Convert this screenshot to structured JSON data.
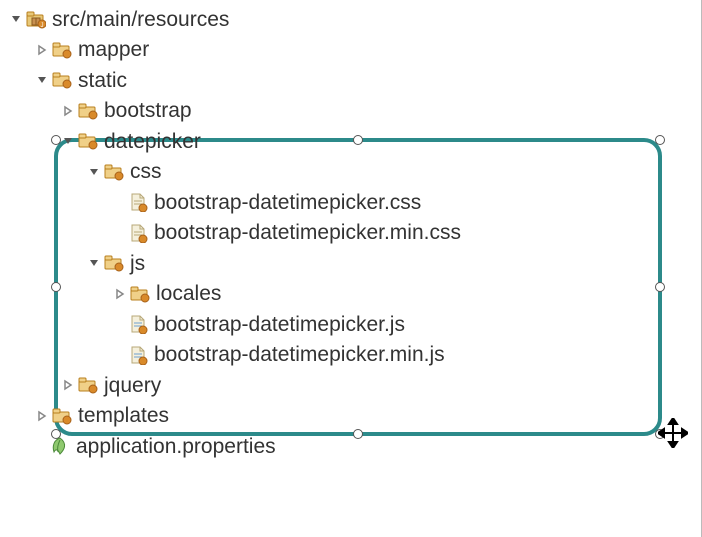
{
  "tree": {
    "root": {
      "label": "src/main/resources",
      "expanded": true,
      "children": {
        "mapper": {
          "label": "mapper",
          "expanded": false
        },
        "static": {
          "label": "static",
          "expanded": true,
          "children": {
            "bootstrap": {
              "label": "bootstrap",
              "expanded": false
            },
            "datepicker": {
              "label": "datepicker",
              "expanded": true,
              "children": {
                "css": {
                  "label": "css",
                  "expanded": true,
                  "children": {
                    "f1": {
                      "label": "bootstrap-datetimepicker.css"
                    },
                    "f2": {
                      "label": "bootstrap-datetimepicker.min.css"
                    }
                  }
                },
                "js": {
                  "label": "js",
                  "expanded": true,
                  "children": {
                    "locales": {
                      "label": "locales",
                      "expanded": false
                    },
                    "f3": {
                      "label": "bootstrap-datetimepicker.js"
                    },
                    "f4": {
                      "label": "bootstrap-datetimepicker.min.js"
                    }
                  }
                }
              }
            },
            "jquery": {
              "label": "jquery",
              "expanded": false
            }
          }
        },
        "templates": {
          "label": "templates",
          "expanded": false
        },
        "appprops": {
          "label": "application.properties"
        }
      }
    }
  },
  "colors": {
    "folder": "#d9a23a",
    "folderDark": "#b87f1e",
    "file": "#e8e0c8",
    "fileBorder": "#b8a878",
    "badge": "#d98a2a",
    "leaf": "#7bb661",
    "highlight": "#2c8a8a"
  }
}
